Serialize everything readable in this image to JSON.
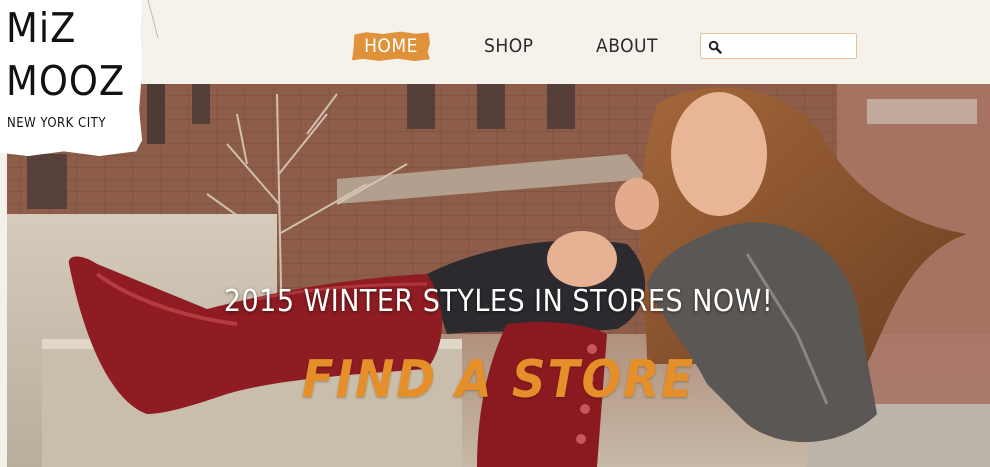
{
  "brand": {
    "logo_line1": "MiZ",
    "logo_line2": "MOOZ",
    "logo_line3": "NEW YORK CITY"
  },
  "nav": {
    "items": [
      {
        "label": "HOME",
        "active": true
      },
      {
        "label": "SHOP",
        "active": false
      },
      {
        "label": "ABOUT",
        "active": false
      }
    ]
  },
  "search": {
    "value": "",
    "placeholder": "",
    "icon": "search-icon"
  },
  "hero": {
    "tagline": "2015 WINTER STYLES IN STORES NOW!",
    "cta": "FIND A STORE"
  },
  "colors": {
    "accent": "#e0923b",
    "cta": "#e48f2a",
    "header_bg": "#f5f2ec",
    "boot_red": "#8e1c22"
  }
}
